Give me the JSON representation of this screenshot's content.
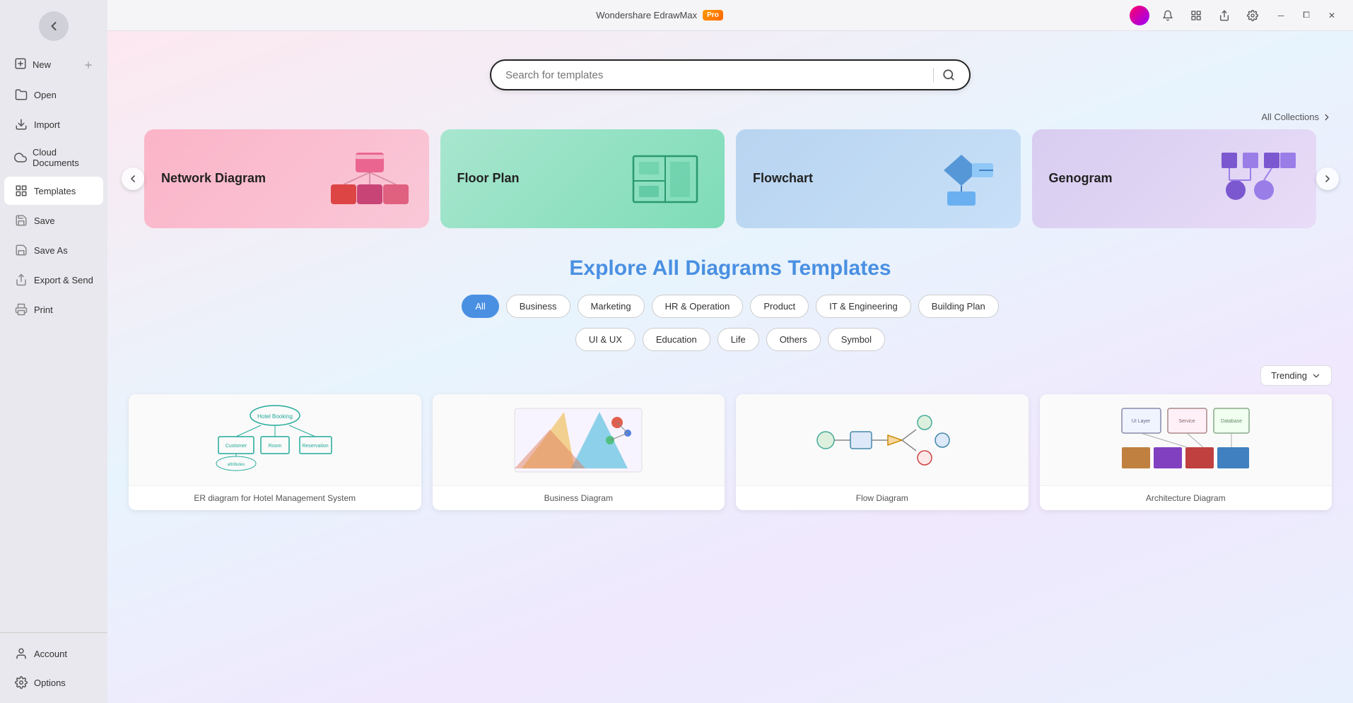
{
  "app": {
    "title": "Wondershare EdrawMax",
    "badge": "Pro",
    "window_controls": [
      "minimize",
      "restore",
      "close"
    ]
  },
  "titlebar": {
    "icons": [
      "help",
      "notification",
      "tools",
      "share",
      "settings"
    ]
  },
  "sidebar": {
    "back_label": "Back",
    "items": [
      {
        "id": "new",
        "label": "New",
        "icon": "plus-square"
      },
      {
        "id": "open",
        "label": "Open",
        "icon": "folder"
      },
      {
        "id": "import",
        "label": "Import",
        "icon": "download"
      },
      {
        "id": "cloud",
        "label": "Cloud Documents",
        "icon": "cloud"
      },
      {
        "id": "templates",
        "label": "Templates",
        "icon": "template",
        "active": true
      },
      {
        "id": "save",
        "label": "Save",
        "icon": "save"
      },
      {
        "id": "saveas",
        "label": "Save As",
        "icon": "save-as"
      },
      {
        "id": "export",
        "label": "Export & Send",
        "icon": "export"
      },
      {
        "id": "print",
        "label": "Print",
        "icon": "print"
      }
    ],
    "bottom_items": [
      {
        "id": "account",
        "label": "Account",
        "icon": "user"
      },
      {
        "id": "options",
        "label": "Options",
        "icon": "gear"
      }
    ]
  },
  "search": {
    "placeholder": "Search for templates"
  },
  "carousel": {
    "all_collections_label": "All Collections",
    "cards": [
      {
        "id": "network",
        "title": "Network Diagram",
        "color": "pink"
      },
      {
        "id": "floor",
        "title": "Floor  Plan",
        "color": "teal"
      },
      {
        "id": "flowchart",
        "title": "Flowchart",
        "color": "blue-light"
      },
      {
        "id": "genogram",
        "title": "Genogram",
        "color": "purple-light"
      }
    ]
  },
  "explore": {
    "title_static": "Explore ",
    "title_highlight": "All Diagrams Templates",
    "tags_row1": [
      {
        "id": "all",
        "label": "All",
        "active": true
      },
      {
        "id": "business",
        "label": "Business",
        "active": false
      },
      {
        "id": "marketing",
        "label": "Marketing",
        "active": false
      },
      {
        "id": "hr",
        "label": "HR & Operation",
        "active": false
      },
      {
        "id": "product",
        "label": "Product",
        "active": false
      },
      {
        "id": "it",
        "label": "IT & Engineering",
        "active": false
      },
      {
        "id": "building",
        "label": "Building Plan",
        "active": false
      }
    ],
    "tags_row2": [
      {
        "id": "ui",
        "label": "UI & UX",
        "active": false
      },
      {
        "id": "education",
        "label": "Education",
        "active": false
      },
      {
        "id": "life",
        "label": "Life",
        "active": false
      },
      {
        "id": "others",
        "label": "Others",
        "active": false
      },
      {
        "id": "symbol",
        "label": "Symbol",
        "active": false
      }
    ],
    "sort_label": "Trending",
    "templates": [
      {
        "id": "t1",
        "label": "ER diagram for Hotel Management System"
      },
      {
        "id": "t2",
        "label": "Business Diagram"
      },
      {
        "id": "t3",
        "label": "Flow Diagram"
      },
      {
        "id": "t4",
        "label": "Architecture Diagram"
      }
    ]
  }
}
